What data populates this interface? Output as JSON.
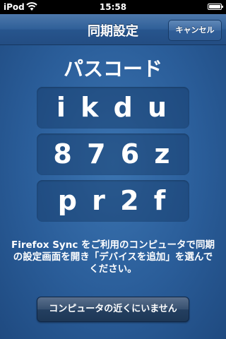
{
  "status_bar": {
    "carrier": "iPod",
    "time": "15:58"
  },
  "nav": {
    "title": "同期設定",
    "cancel_label": "キャンセル"
  },
  "main": {
    "heading": "パスコード",
    "codes": [
      "i k d u",
      "8 7 6 z",
      "p r 2 f"
    ],
    "instructions": "Firefox Sync をご利用のコンピュータで同期の設定画面を開き「デバイスを追加」を選んでください。",
    "not_near_button": "コンピュータの近くにいません"
  },
  "colors": {
    "background": "#2a5d99",
    "navbar": "#2f5f98"
  }
}
